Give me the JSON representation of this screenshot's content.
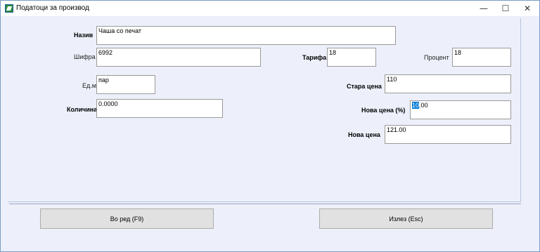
{
  "window": {
    "title": "Податоци за производ",
    "controls": {
      "minimize": "—",
      "maximize": "☐",
      "close": "✕"
    }
  },
  "form": {
    "naziv": {
      "label": "Назив",
      "value": "Чаша со печат"
    },
    "shifra": {
      "label": "Шифра",
      "value": "6992"
    },
    "tarifa": {
      "label": "Тарифа",
      "value": "18"
    },
    "procent": {
      "label": "Процент",
      "value": "18"
    },
    "edm": {
      "label": "Ед.м",
      "value": "пар"
    },
    "stara_cena": {
      "label": "Стара цена",
      "value": "110"
    },
    "kolicina": {
      "label": "Количина",
      "value": "0.0000"
    },
    "nova_cena_pct": {
      "label": "Нова цена (%)",
      "value_selected": "10",
      "value_rest": ".00"
    },
    "nova_cena": {
      "label": "Нова цена",
      "value": "121.00"
    }
  },
  "buttons": {
    "ok": "Во ред (F9)",
    "exit": "Излез (Esc)"
  }
}
